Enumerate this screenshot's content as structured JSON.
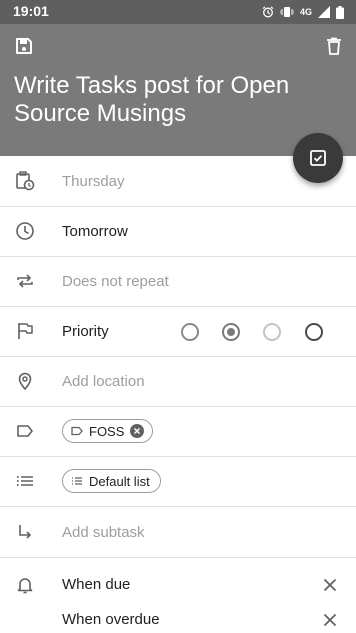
{
  "status_bar": {
    "time": "19:01",
    "network": "4G"
  },
  "task": {
    "title": "Write Tasks post for Open Source Musings"
  },
  "fields": {
    "due_date": {
      "value": "Thursday"
    },
    "due_time": {
      "value": "Tomorrow"
    },
    "repeat": {
      "placeholder": "Does not repeat"
    },
    "priority": {
      "label": "Priority",
      "selected_index": 1
    },
    "location": {
      "placeholder": "Add location"
    },
    "tags": [
      {
        "label": "FOSS"
      }
    ],
    "list": {
      "label": "Default list"
    },
    "subtask": {
      "placeholder": "Add subtask"
    },
    "reminders": [
      {
        "label": "When due"
      },
      {
        "label": "When overdue"
      }
    ]
  },
  "colors": {
    "status_bar": "#5f5f5f",
    "header": "#7a7a7a",
    "fab": "#3a3a3a",
    "divider": "#e0e0e0",
    "hint_text": "#9e9e9e"
  },
  "icons": {
    "save": "save-icon",
    "delete": "delete-icon",
    "complete": "check-box-icon",
    "due_date": "calendar-clock-icon",
    "due_time": "clock-icon",
    "repeat": "repeat-icon",
    "priority": "flag-icon",
    "location": "location-pin-icon",
    "tags": "label-icon",
    "list": "list-icon",
    "subtask": "subdirectory-arrow-icon",
    "reminders": "bell-icon"
  }
}
